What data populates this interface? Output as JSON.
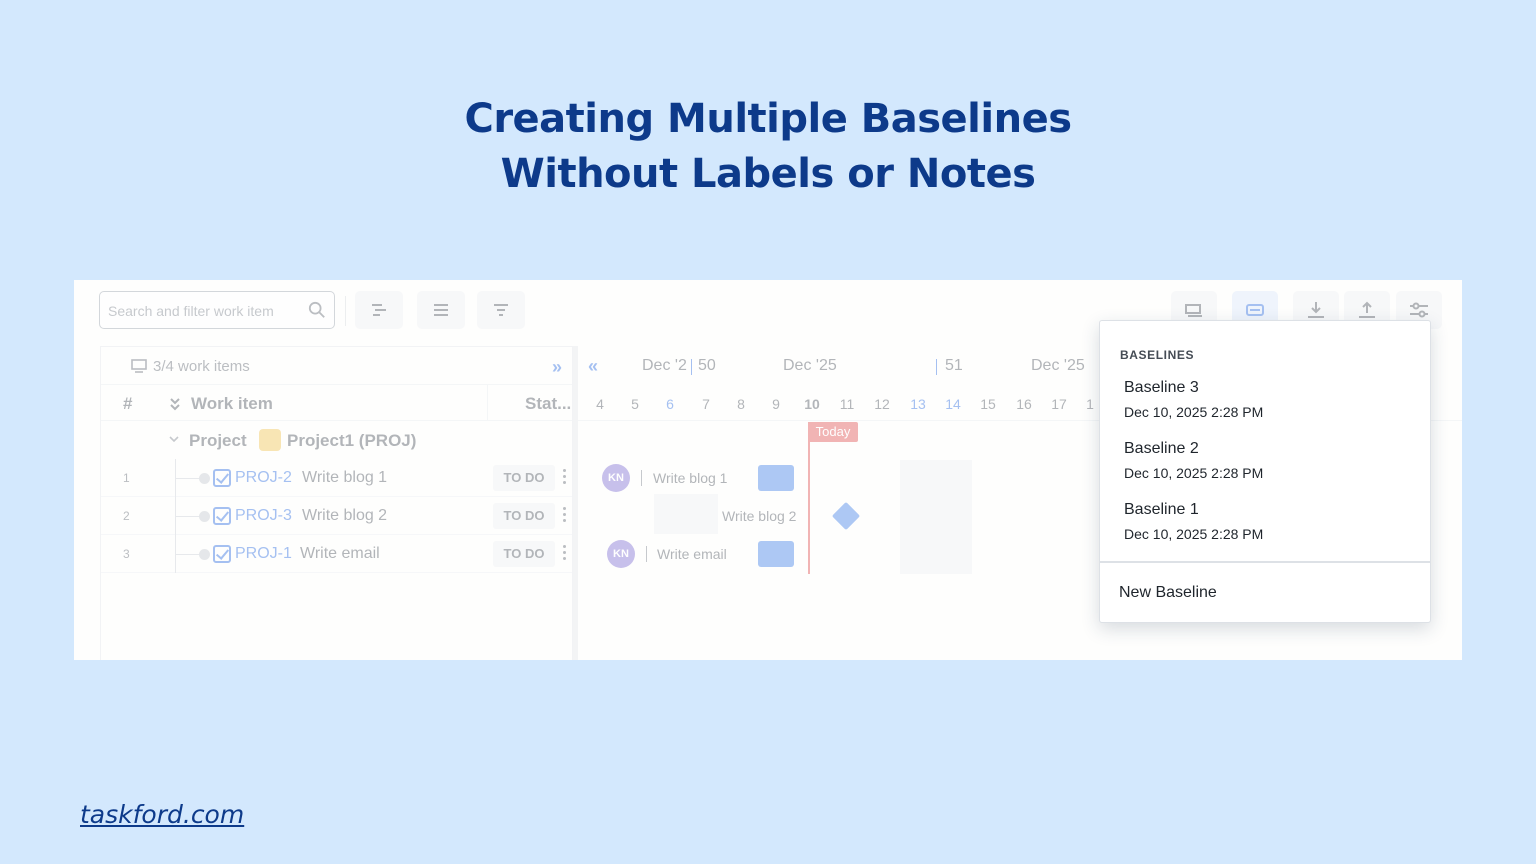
{
  "headline": {
    "line1": "Creating Multiple Baselines",
    "line2": "Without Labels or Notes"
  },
  "footer": {
    "link": "taskford.com"
  },
  "toolbar": {
    "search_placeholder": "Search and filter work item",
    "left_buttons": [
      "gantt-view-icon",
      "list-view-icon",
      "filter-icon"
    ],
    "right_buttons": [
      "baseline-compare-icon",
      "baseline-icon",
      "download-icon",
      "upload-icon",
      "settings-sliders-icon"
    ]
  },
  "left_panel": {
    "count_text": "3/4 work items",
    "columns": {
      "num": "#",
      "work_item": "Work item",
      "status": "Stat..."
    },
    "group": {
      "label": "Project",
      "name": "Project1 (PROJ)"
    },
    "rows": [
      {
        "num": "1",
        "key": "PROJ-2",
        "title": "Write blog 1",
        "status": "TO DO"
      },
      {
        "num": "2",
        "key": "PROJ-3",
        "title": "Write blog 2",
        "status": "TO DO"
      },
      {
        "num": "3",
        "key": "PROJ-1",
        "title": "Write email",
        "status": "TO DO"
      }
    ]
  },
  "gantt": {
    "months": [
      "Dec '2",
      "Dec '25",
      "Dec '25"
    ],
    "weeks": [
      "50",
      "51"
    ],
    "days": [
      "4",
      "5",
      "6",
      "7",
      "8",
      "9",
      "10",
      "11",
      "12",
      "13",
      "14",
      "15",
      "16",
      "17",
      "1"
    ],
    "today_label": "Today",
    "bars": [
      {
        "assignee": "KN",
        "label": "Write blog 1"
      },
      {
        "label": "Write blog 2"
      },
      {
        "assignee": "KN",
        "label": "Write email"
      }
    ]
  },
  "baselines_menu": {
    "heading": "BASELINES",
    "items": [
      {
        "name": "Baseline 3",
        "date": "Dec 10, 2025 2:28 PM"
      },
      {
        "name": "Baseline 2",
        "date": "Dec 10, 2025 2:28 PM"
      },
      {
        "name": "Baseline 1",
        "date": "Dec 10, 2025 2:28 PM"
      }
    ],
    "new_label": "New Baseline"
  },
  "colors": {
    "background": "#d3e8fd",
    "headline": "#0d3a8a",
    "accent": "#2b6de0",
    "today": "#e04f4f"
  }
}
